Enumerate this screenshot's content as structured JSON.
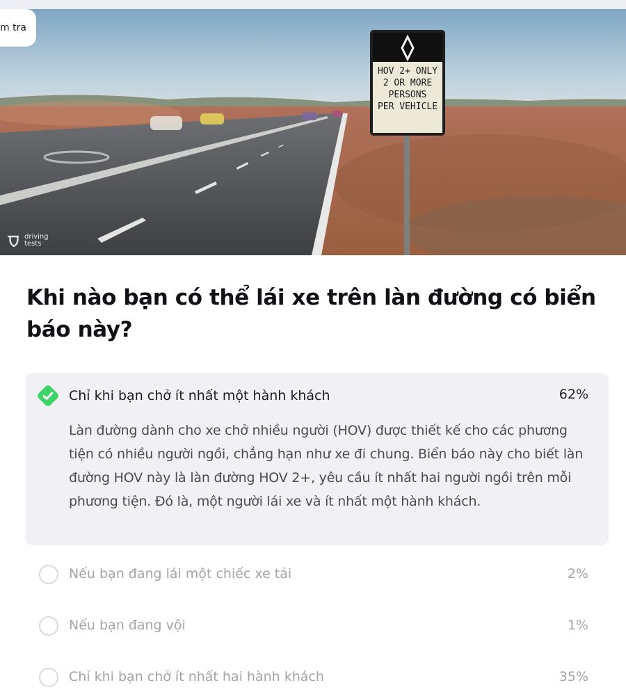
{
  "header": {
    "tab_label": "m tra"
  },
  "hero_image": {
    "watermark": "driving tests",
    "sign_lines": [
      "HOV 2+ ONLY",
      "2 OR MORE",
      "PERSONS",
      "PER VEHICLE"
    ],
    "sign_symbol": "diamond-icon"
  },
  "question": {
    "text": "Khi nào bạn có thể lái xe trên làn đường có biển báo này?"
  },
  "answers": [
    {
      "label": "Chỉ khi bạn chở ít nhất một hành khách",
      "percent": "62%",
      "correct": true,
      "explanation": "Làn đường dành cho xe chở nhiều người (HOV) được thiết kế cho các phương tiện có nhiều người ngồi, chẳng hạn như xe đi chung. Biển báo này cho biết làn đường HOV này là làn đường HOV 2+, yêu cầu ít nhất hai người ngồi trên mỗi phương tiện. Đó là, một người lái xe và ít nhất một hành khách."
    },
    {
      "label": "Nếu bạn đang lái một chiếc xe tải",
      "percent": "2%",
      "correct": false
    },
    {
      "label": "Nếu bạn đang vội",
      "percent": "1%",
      "correct": false
    },
    {
      "label": "Chỉ khi bạn chở ít nhất hai hành khách",
      "percent": "35%",
      "correct": false
    }
  ],
  "colors": {
    "correct_green": "#3fd46a",
    "selected_bg": "#f1f1f5",
    "muted_text": "#a3a4aa"
  }
}
